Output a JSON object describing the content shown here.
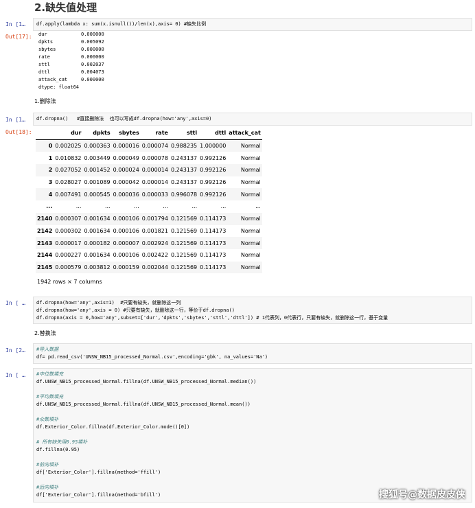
{
  "heading": "2.缺失值处理",
  "cells": {
    "c1_prompt": "In [1…",
    "c1_code": [
      "df.apply(lambda x: sum(x.isnull())/len(x),axis= 0) #缺失比例"
    ],
    "c1_out_prompt": "Out[17]:",
    "c1_series": [
      {
        "k": "dur",
        "v": "0.000000"
      },
      {
        "k": "dpkts",
        "v": "0.005092"
      },
      {
        "k": "sbytes",
        "v": "0.000000"
      },
      {
        "k": "rate",
        "v": "0.000000"
      },
      {
        "k": "sttl",
        "v": "0.002037"
      },
      {
        "k": "dttl",
        "v": "0.004073"
      },
      {
        "k": "attack_cat",
        "v": "0.000000"
      }
    ],
    "c1_dtype": "dtype: float64",
    "md_delete": "1.删除法",
    "c2_prompt": "In [1…",
    "c2_code": [
      "df.dropna()   #直接删除法  也可以写成df.dropna(how='any',axis=0)"
    ],
    "c2_out_prompt": "Out[18]:",
    "table": {
      "columns": [
        "",
        "dur",
        "dpkts",
        "sbytes",
        "rate",
        "sttl",
        "dttl",
        "attack_cat"
      ],
      "rows": [
        [
          "0",
          "0.002025",
          "0.000363",
          "0.000016",
          "0.000074",
          "0.988235",
          "1.000000",
          "Normal"
        ],
        [
          "1",
          "0.010832",
          "0.003449",
          "0.000049",
          "0.000078",
          "0.243137",
          "0.992126",
          "Normal"
        ],
        [
          "2",
          "0.027052",
          "0.001452",
          "0.000024",
          "0.000014",
          "0.243137",
          "0.992126",
          "Normal"
        ],
        [
          "3",
          "0.028027",
          "0.001089",
          "0.000042",
          "0.000014",
          "0.243137",
          "0.992126",
          "Normal"
        ],
        [
          "4",
          "0.007491",
          "0.000545",
          "0.000036",
          "0.000033",
          "0.996078",
          "0.992126",
          "Normal"
        ],
        [
          "...",
          "...",
          "...",
          "...",
          "...",
          "...",
          "...",
          "..."
        ],
        [
          "2140",
          "0.000307",
          "0.001634",
          "0.000106",
          "0.001794",
          "0.121569",
          "0.114173",
          "Normal"
        ],
        [
          "2142",
          "0.000302",
          "0.001634",
          "0.000106",
          "0.001821",
          "0.121569",
          "0.114173",
          "Normal"
        ],
        [
          "2143",
          "0.000017",
          "0.000182",
          "0.000007",
          "0.002924",
          "0.121569",
          "0.114173",
          "Normal"
        ],
        [
          "2144",
          "0.000227",
          "0.001634",
          "0.000106",
          "0.002422",
          "0.121569",
          "0.114173",
          "Normal"
        ],
        [
          "2145",
          "0.000579",
          "0.003812",
          "0.000159",
          "0.002044",
          "0.121569",
          "0.114173",
          "Normal"
        ]
      ]
    },
    "df_shape": "1942 rows × 7 columns",
    "c3_prompt": "In [ …",
    "c3_code": [
      "df.dropna(how='any',axis=1)  #只要有缺失，就删除这一列",
      "df.dropna(how='any',axis = 0) #只要有缺失，就删除这一行，等价于df.dropna()",
      "df.dropna(axis = 0,how='any',subset=['dur','dpkts','sbytes','sttl','dttl']) # 1代表列，0代表行，只要有缺失，就删除这一行，基于变量"
    ],
    "md_replace": "2.替换法",
    "c4_prompt": "In [2…",
    "c4_code": [
      "#导入数据",
      "df= pd.read_csv('UNSW_NB15_processed_Normal.csv',encoding='gbk', na_values='Na')"
    ],
    "c5_prompt": "In [ …",
    "c5_code": [
      "#中位数填充",
      "df.UNSW_NB15_processed_Normal.fillna(df.UNSW_NB15_processed_Normal.median())",
      "",
      "#平均数填充",
      "df.UNSW_NB15_processed_Normal.fillna(df.UNSW_NB15_processed_Normal.mean())",
      "",
      "#众数填补",
      "df.Exterior_Color.fillna(df.Exterior_Color.mode()[0])",
      "",
      "# 所有缺失用0.95填补",
      "df.fillna(0.95)",
      "",
      "#前向填补",
      "df['Exterior_Color'].fillna(method='ffill')",
      "",
      "#后向填补",
      "df['Exterior_Color'].fillna(method='bfill')"
    ]
  },
  "watermark": "搜狐号@数据皮皮侠"
}
